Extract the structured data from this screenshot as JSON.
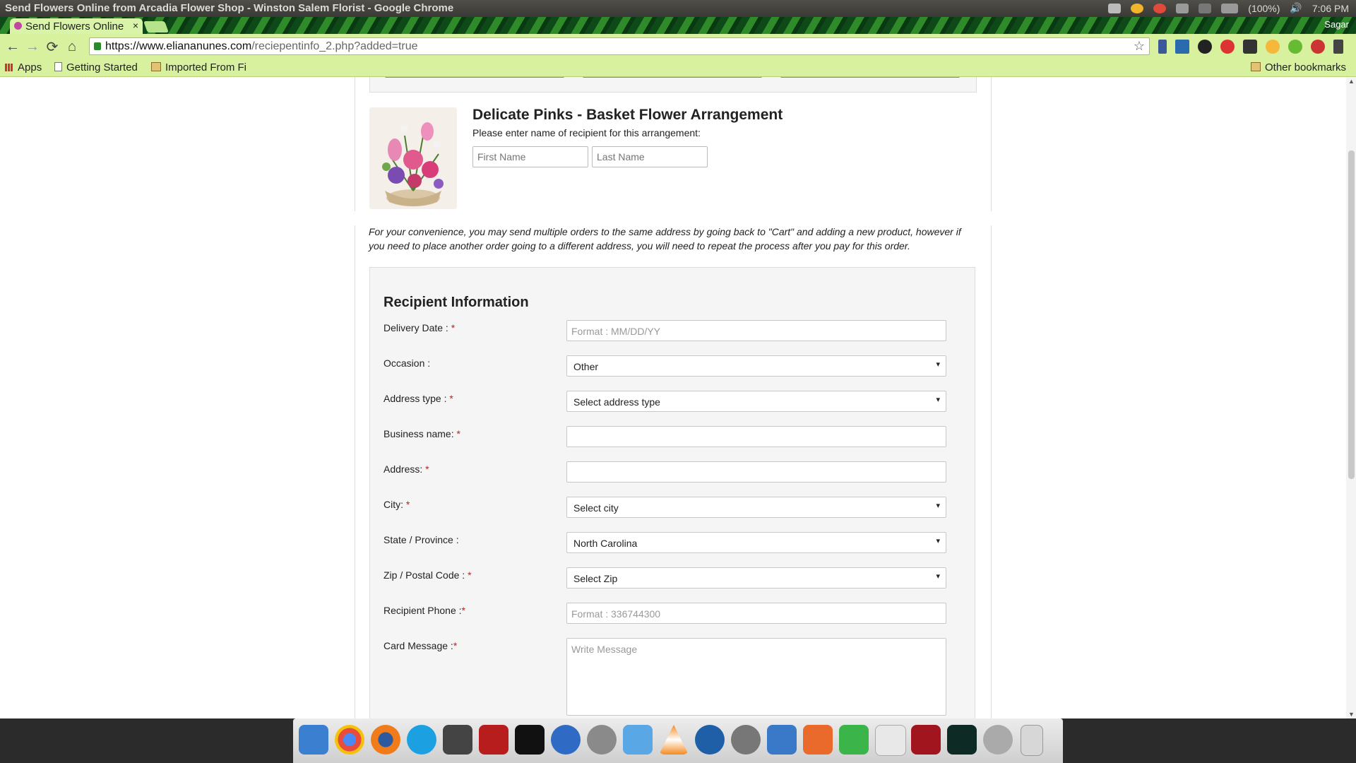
{
  "os": {
    "window_title": "Send Flowers Online from Arcadia Flower Shop - Winston Salem Florist - Google Chrome",
    "battery": "(100%)",
    "clock": "7:06 PM"
  },
  "browser": {
    "user_name": "Sagar",
    "tab_title": "Send Flowers Online",
    "tab_close": "×",
    "url_host": "https://www.eliananunes.com",
    "url_path": "/reciepentinfo_2.php?added=true",
    "bookmarks": {
      "apps": "Apps",
      "getting_started": "Getting Started",
      "imported": "Imported From Fi",
      "other": "Other bookmarks"
    }
  },
  "product": {
    "title": "Delicate Pinks - Basket Flower Arrangement",
    "subtitle": "Please enter name of recipient for this arrangement:",
    "first_name_placeholder": "First Name",
    "last_name_placeholder": "Last Name"
  },
  "note": "For your convenience, you may send multiple orders to the same address by going back to \"Cart\" and adding a new product, however if you need to place another order going to a different address, you will need to repeat the process after you pay for this order.",
  "form": {
    "title": "Recipient Information",
    "fields": {
      "delivery_date": {
        "label": "Delivery Date : ",
        "required": "*",
        "placeholder": "Format : MM/DD/YY"
      },
      "occasion": {
        "label": "Occasion :",
        "value": "Other"
      },
      "address_type": {
        "label": "Address type : ",
        "required": "*",
        "value": "Select address type"
      },
      "business_name": {
        "label": "Business name: ",
        "required": "*"
      },
      "address": {
        "label": "Address: ",
        "required": "*"
      },
      "city": {
        "label": "City: ",
        "required": "*",
        "value": "Select city"
      },
      "state": {
        "label": "State / Province :",
        "value": "North Carolina"
      },
      "zip": {
        "label": "Zip / Postal Code : ",
        "required": "*",
        "value": "Select Zip"
      },
      "phone": {
        "label": "Recipient Phone :",
        "required": "*",
        "placeholder": "Format : 336744300"
      },
      "card_message": {
        "label": "Card Message :",
        "required": "*",
        "placeholder": "Write Message"
      }
    }
  },
  "icons": {
    "back": "←",
    "forward": "→",
    "reload": "⟳",
    "home": "⌂",
    "star": "☆",
    "caret": "▾",
    "scroll_up": "▲",
    "scroll_down": "▼",
    "speaker": "🔊"
  },
  "colors": {
    "chrome_green": "#d7f19f",
    "required_red": "#dd1111",
    "button_green": "#4fb14f"
  }
}
